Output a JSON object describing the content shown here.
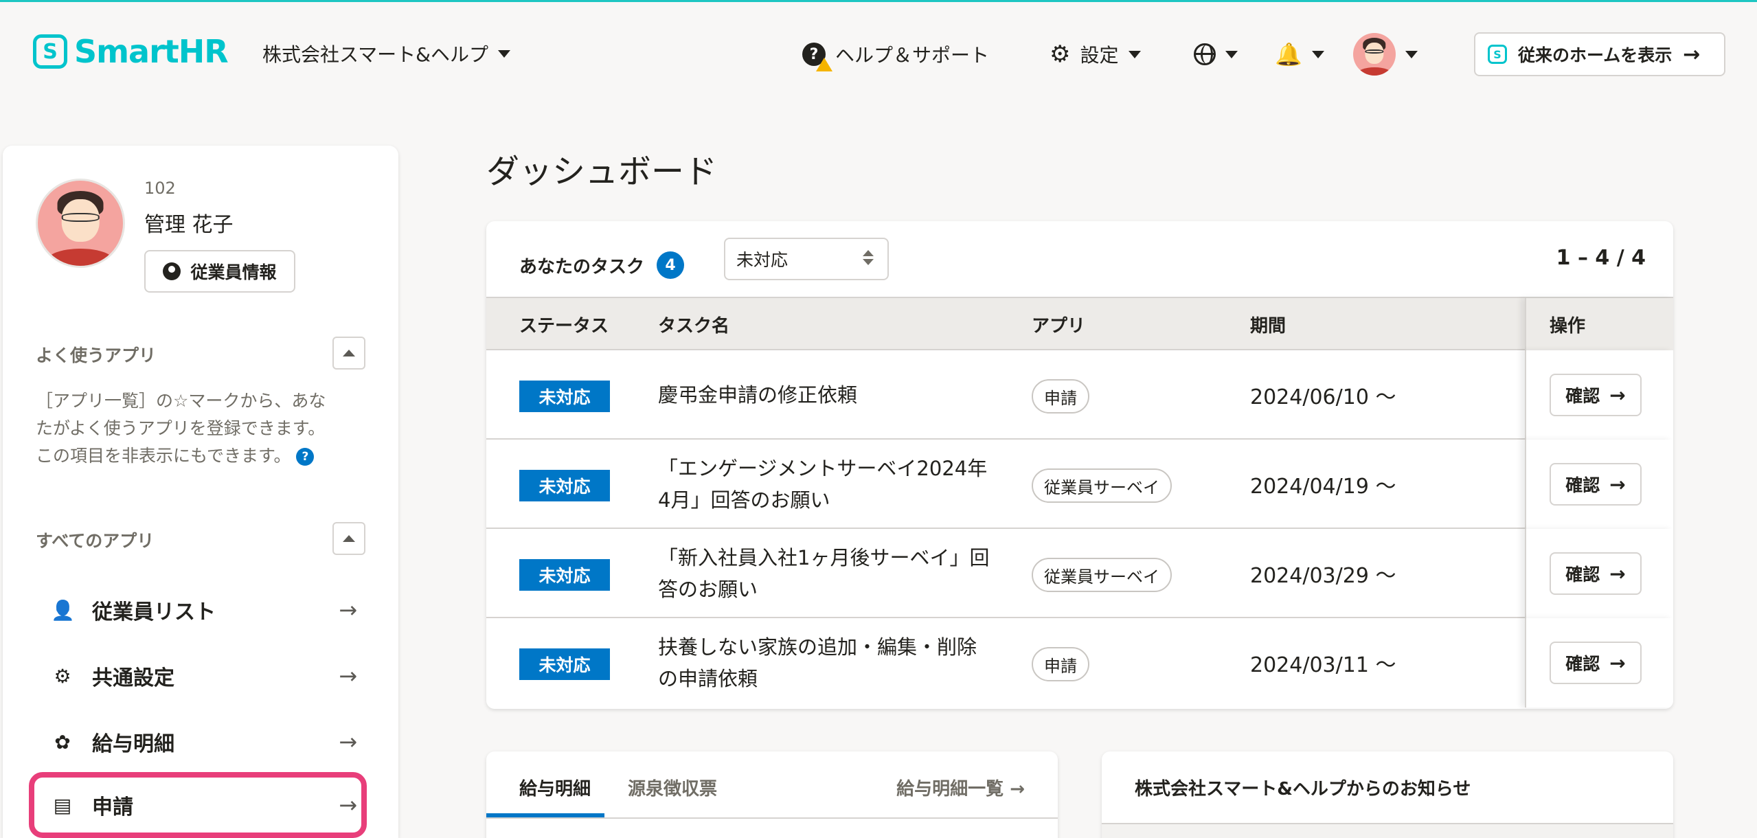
{
  "header": {
    "logo_text": "SmartHR",
    "logo_mark": "S",
    "company": "株式会社スマート&ヘルプ",
    "help_label": "ヘルプ＆サポート",
    "settings_label": "設定",
    "old_home_button": "従来のホームを表示",
    "old_home_arrow": "→"
  },
  "profile": {
    "employee_number": "102",
    "name": "管理 花子",
    "info_button": "従業員情報"
  },
  "sidebar": {
    "favorites_title": "よく使うアプリ",
    "favorites_desc_1": "［アプリ一覧］の☆マークから、あな",
    "favorites_desc_2": "たがよく使うアプリを登録できます。",
    "favorites_desc_3": "この項目を非表示にもできます。",
    "help_q": "?",
    "all_apps_title": "すべてのアプリ",
    "apps": [
      {
        "label": "従業員リスト",
        "icon": "person-icon"
      },
      {
        "label": "共通設定",
        "icon": "gear-icon"
      },
      {
        "label": "給与明細",
        "icon": "payslip-icon"
      },
      {
        "label": "申請",
        "icon": "application-icon"
      }
    ],
    "arrow": "→"
  },
  "main": {
    "title": "ダッシュボード",
    "tasks": {
      "title": "あなたのタスク",
      "count": "4",
      "filter_value": "未対応",
      "pager": "1 – 4 / 4",
      "columns": [
        "ステータス",
        "タスク名",
        "アプリ",
        "期間",
        "操作"
      ],
      "rows": [
        {
          "status": "未対応",
          "name": "慶弔金申請の修正依頼",
          "app": "申請",
          "period": "2024/06/10 〜",
          "action": "確認"
        },
        {
          "status": "未対応",
          "name": "「エンゲージメントサーベイ2024年4月」回答のお願い",
          "app": "従業員サーベイ",
          "period": "2024/04/19 〜",
          "action": "確認"
        },
        {
          "status": "未対応",
          "name": "「新入社員入社1ヶ月後サーベイ」回答のお願い",
          "app": "従業員サーベイ",
          "period": "2024/03/29 〜",
          "action": "確認"
        },
        {
          "status": "未対応",
          "name": "扶養しない家族の追加・編集・削除の申請依頼",
          "app": "申請",
          "period": "2024/03/11 〜",
          "action": "確認"
        }
      ],
      "action_arrow": "→"
    },
    "payslip": {
      "tab_active": "給与明細",
      "tab_2": "源泉徴収票",
      "link": "給与明細一覧",
      "link_arrow": "→"
    },
    "notice": {
      "title": "株式会社スマート&ヘルプからのお知らせ"
    }
  },
  "colors": {
    "brand": "#00c4cc",
    "primary": "#0077c7",
    "highlight": "#e83e7a"
  }
}
